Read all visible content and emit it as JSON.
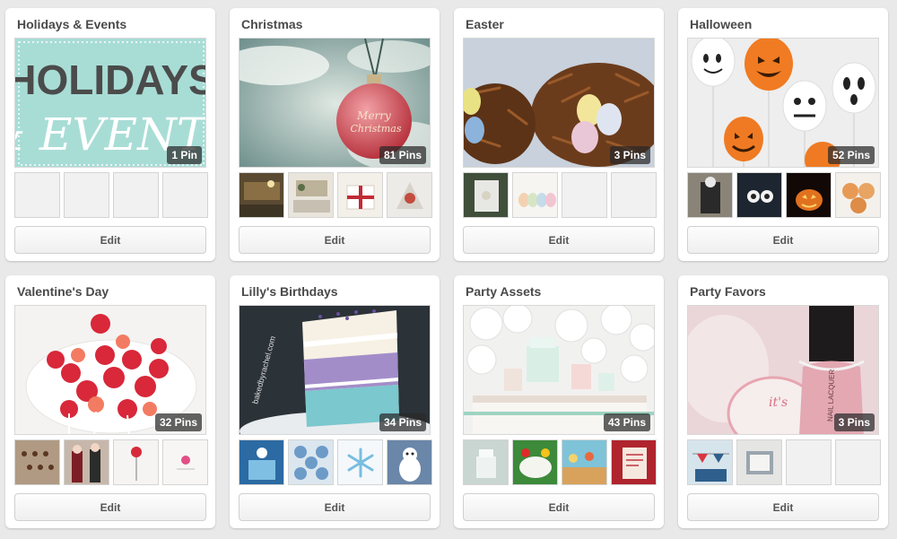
{
  "boards": [
    {
      "title": "Holidays & Events",
      "pin_count": "1 Pin",
      "edit_label": "Edit",
      "cover_text": [
        "HOLIDAYS",
        "& EVENTS"
      ],
      "cover": "holidays-events-cover",
      "thumbs": [
        "empty",
        "empty",
        "empty",
        "empty"
      ]
    },
    {
      "title": "Christmas",
      "pin_count": "81 Pins",
      "edit_label": "Edit",
      "cover": "christmas-ornament-photo",
      "cover_text": [
        "Merry",
        "Christmas"
      ],
      "thumbs": [
        "room-photo",
        "room-photo",
        "gift-photo",
        "craft-photo"
      ]
    },
    {
      "title": "Easter",
      "pin_count": "3 Pins",
      "edit_label": "Edit",
      "cover": "easter-nests-photo",
      "thumbs": [
        "bunny-frame-photo",
        "eggs-photo",
        "empty",
        "empty"
      ]
    },
    {
      "title": "Halloween",
      "pin_count": "52 Pins",
      "edit_label": "Edit",
      "cover": "halloween-balloons-photo",
      "thumbs": [
        "costume-photo",
        "eyes-photo",
        "pumpkin-photo",
        "cookies-photo"
      ]
    },
    {
      "title": "Valentine's Day",
      "pin_count": "32 Pins",
      "edit_label": "Edit",
      "cover": "strawberry-hearts-photo",
      "thumbs": [
        "treats-photo",
        "people-photo",
        "lollipop-photo",
        "card-photo"
      ]
    },
    {
      "title": "Lilly's Birthdays",
      "pin_count": "34 Pins",
      "edit_label": "Edit",
      "cover": "layer-cake-photo",
      "cover_text": [
        "bakedbyrachel.com"
      ],
      "thumbs": [
        "frozen-party-photo",
        "snowflake-cookies-photo",
        "snowflake-photo",
        "olaf-photo"
      ]
    },
    {
      "title": "Party Assets",
      "pin_count": "43 Pins",
      "edit_label": "Edit",
      "cover": "dessert-table-photo",
      "thumbs": [
        "cake-photo",
        "cake-photo",
        "party-photo",
        "poster-photo"
      ]
    },
    {
      "title": "Party Favors",
      "pin_count": "3 Pins",
      "edit_label": "Edit",
      "cover": "nail-polish-favors-photo",
      "cover_text": [
        "NAIL LACQUER",
        "it's"
      ],
      "thumbs": [
        "flags-photo",
        "box-photo",
        "empty",
        "empty"
      ]
    }
  ],
  "colors": {
    "page_bg": "#e9e9e9",
    "card_bg": "#ffffff",
    "title_text": "#4a4a4a",
    "badge_bg": "#333333",
    "holidays_cover_bg": "#a8ddd6",
    "holidays_cover_text": "#4b4b4b"
  }
}
